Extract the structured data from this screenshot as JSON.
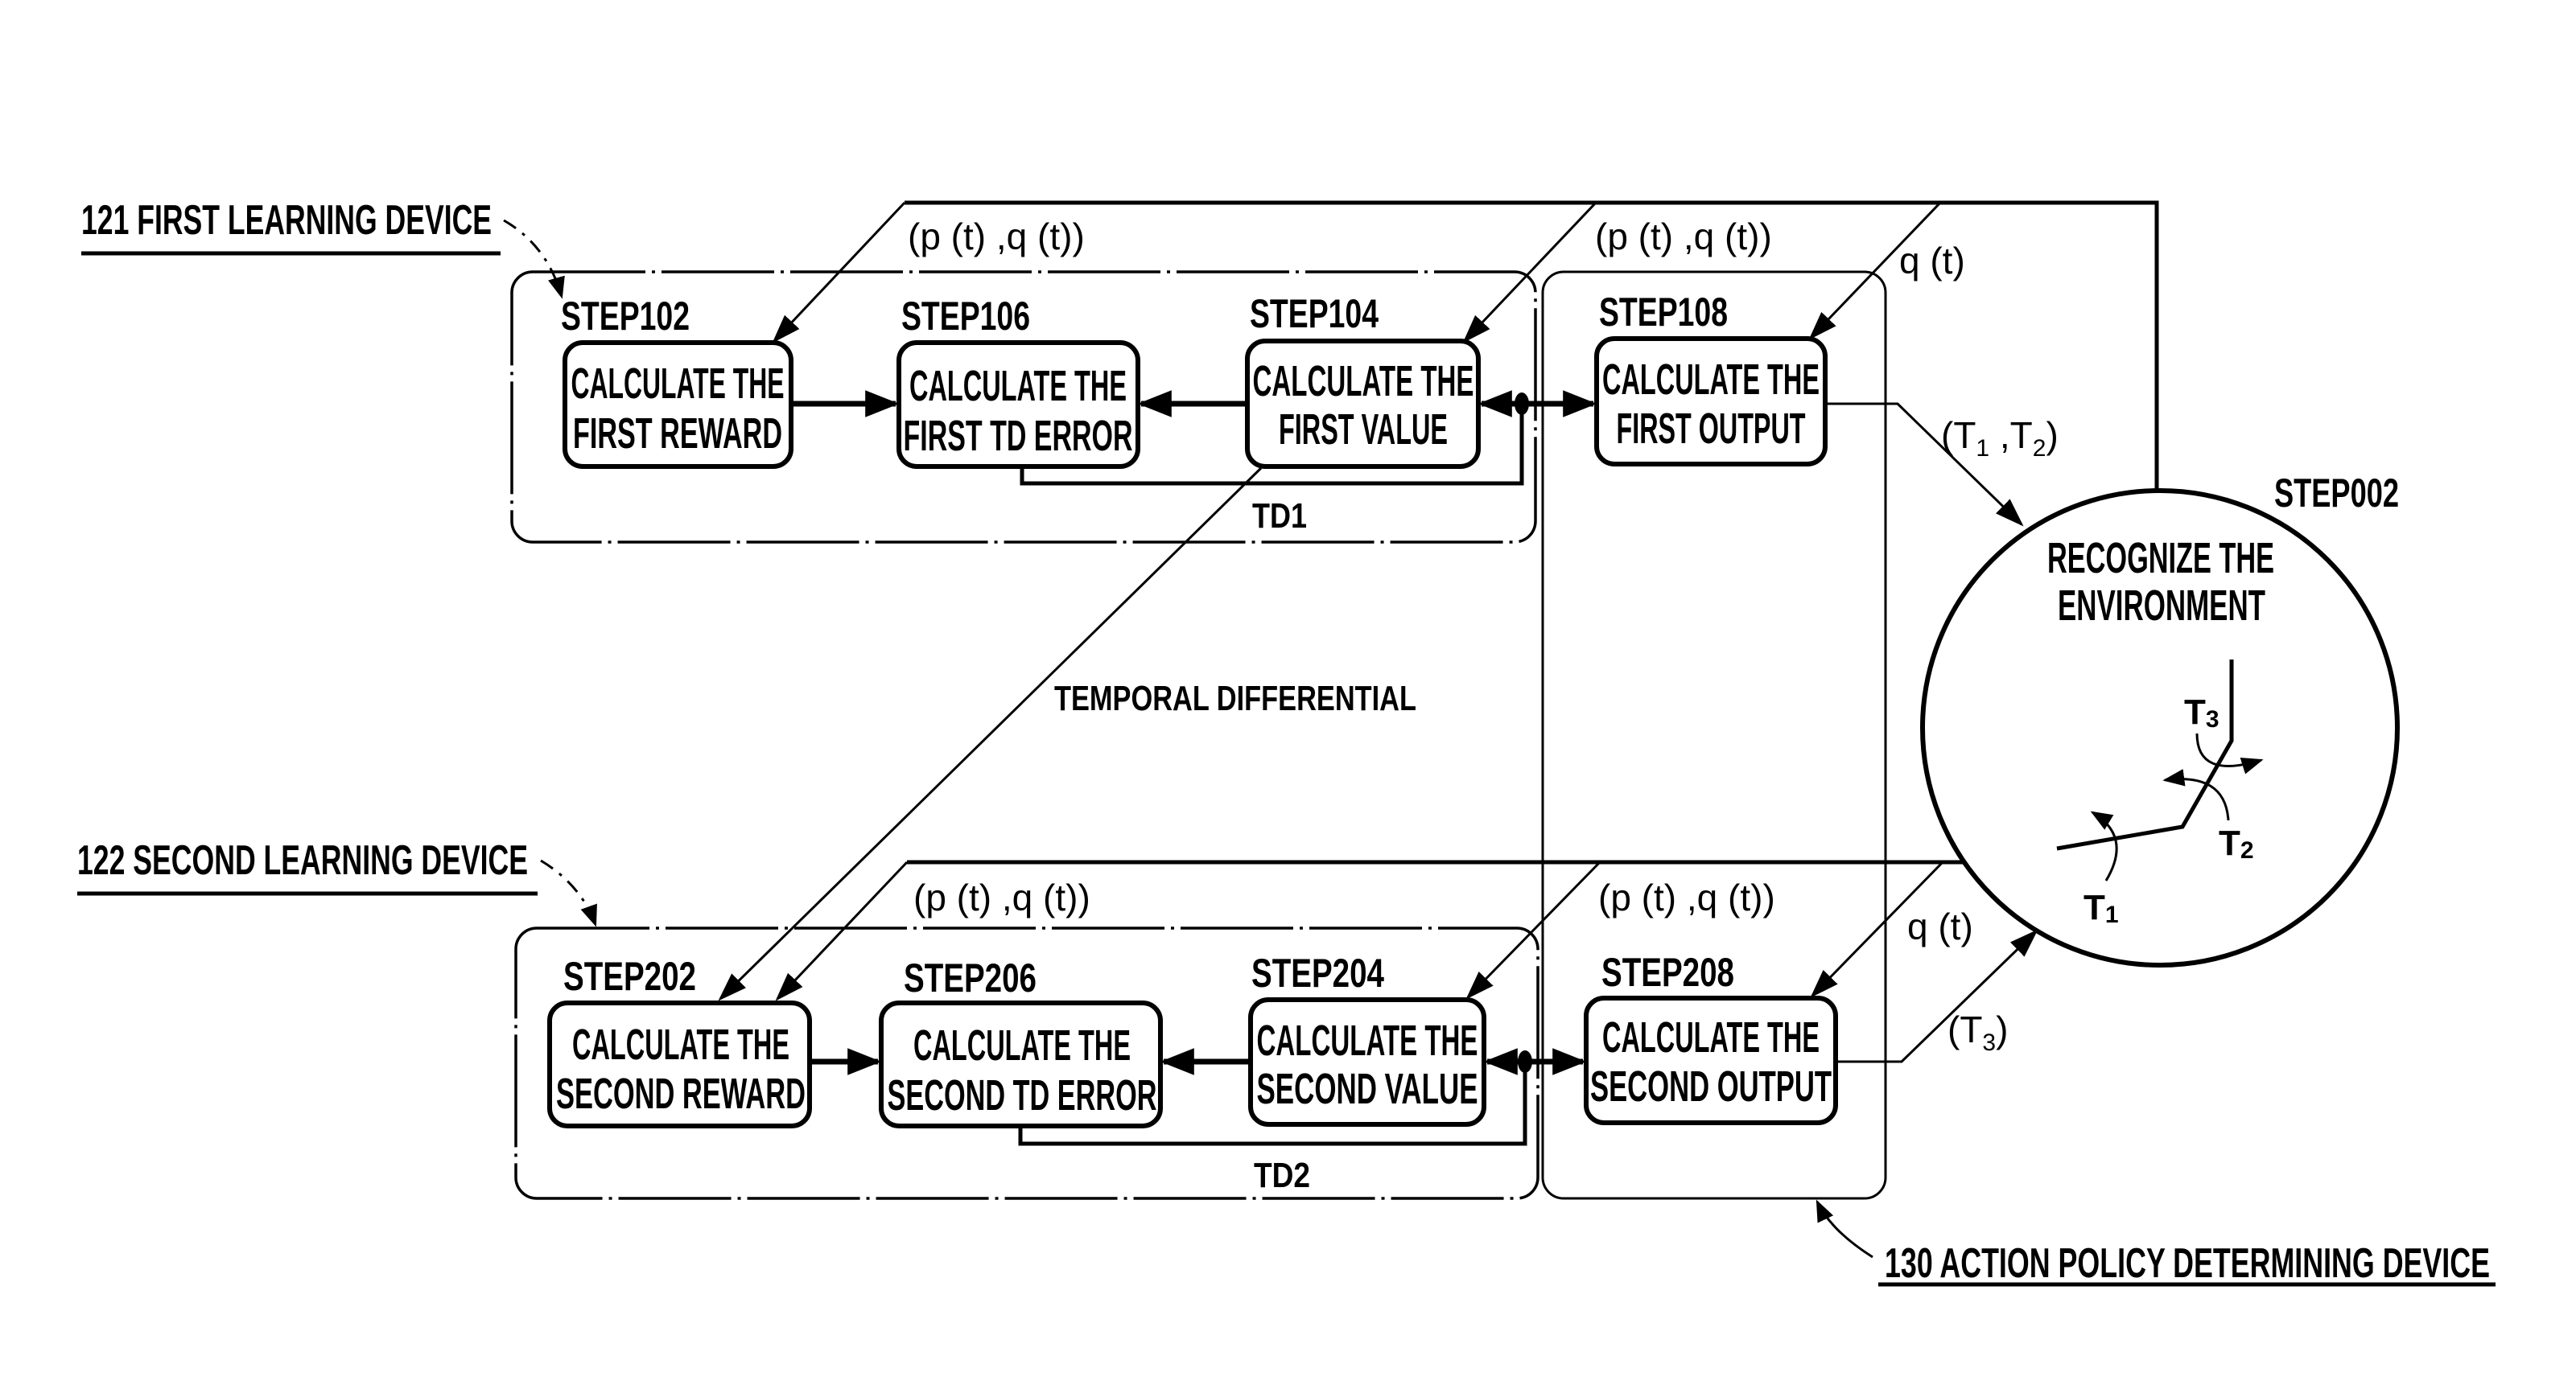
{
  "labels": {
    "first_learning_device": "121 FIRST LEARNING DEVICE",
    "second_learning_device": "122 SECOND LEARNING DEVICE",
    "action_policy_device": "130 ACTION POLICY DETERMINING DEVICE",
    "temporal_differential": "TEMPORAL DIFFERENTIAL",
    "td1": "TD1",
    "td2": "TD2"
  },
  "first_row": {
    "step102": {
      "step": "STEP102",
      "line1": "CALCULATE THE",
      "line2": "FIRST REWARD"
    },
    "step106": {
      "step": "STEP106",
      "line1": "CALCULATE THE",
      "line2": "FIRST TD ERROR"
    },
    "step104": {
      "step": "STEP104",
      "line1": "CALCULATE THE",
      "line2": "FIRST VALUE"
    },
    "step108": {
      "step": "STEP108",
      "line1": "CALCULATE THE",
      "line2": "FIRST OUTPUT"
    }
  },
  "second_row": {
    "step202": {
      "step": "STEP202",
      "line1": "CALCULATE THE",
      "line2": "SECOND REWARD"
    },
    "step206": {
      "step": "STEP206",
      "line1": "CALCULATE THE",
      "line2": "SECOND TD ERROR"
    },
    "step204": {
      "step": "STEP204",
      "line1": "CALCULATE THE",
      "line2": "SECOND VALUE"
    },
    "step208": {
      "step": "STEP208",
      "line1": "CALCULATE THE",
      "line2": "SECOND OUTPUT"
    }
  },
  "environment": {
    "step": "STEP002",
    "line1": "RECOGNIZE THE",
    "line2": "ENVIRONMENT",
    "joints": {
      "t1": "T",
      "t1_sub": "1",
      "t2": "T",
      "t2_sub": "2",
      "t3": "T",
      "t3_sub": "3"
    }
  },
  "signals": {
    "pq": "(p (t) ,q (t))",
    "q": "q (t)",
    "t1t2_open": "(T",
    "t1t2_sub1": "1",
    "t1t2_mid": " ,T",
    "t1t2_sub2": "2",
    "t1t2_close": ")",
    "t3_open": "(T",
    "t3_sub": "3",
    "t3_close": ")"
  }
}
